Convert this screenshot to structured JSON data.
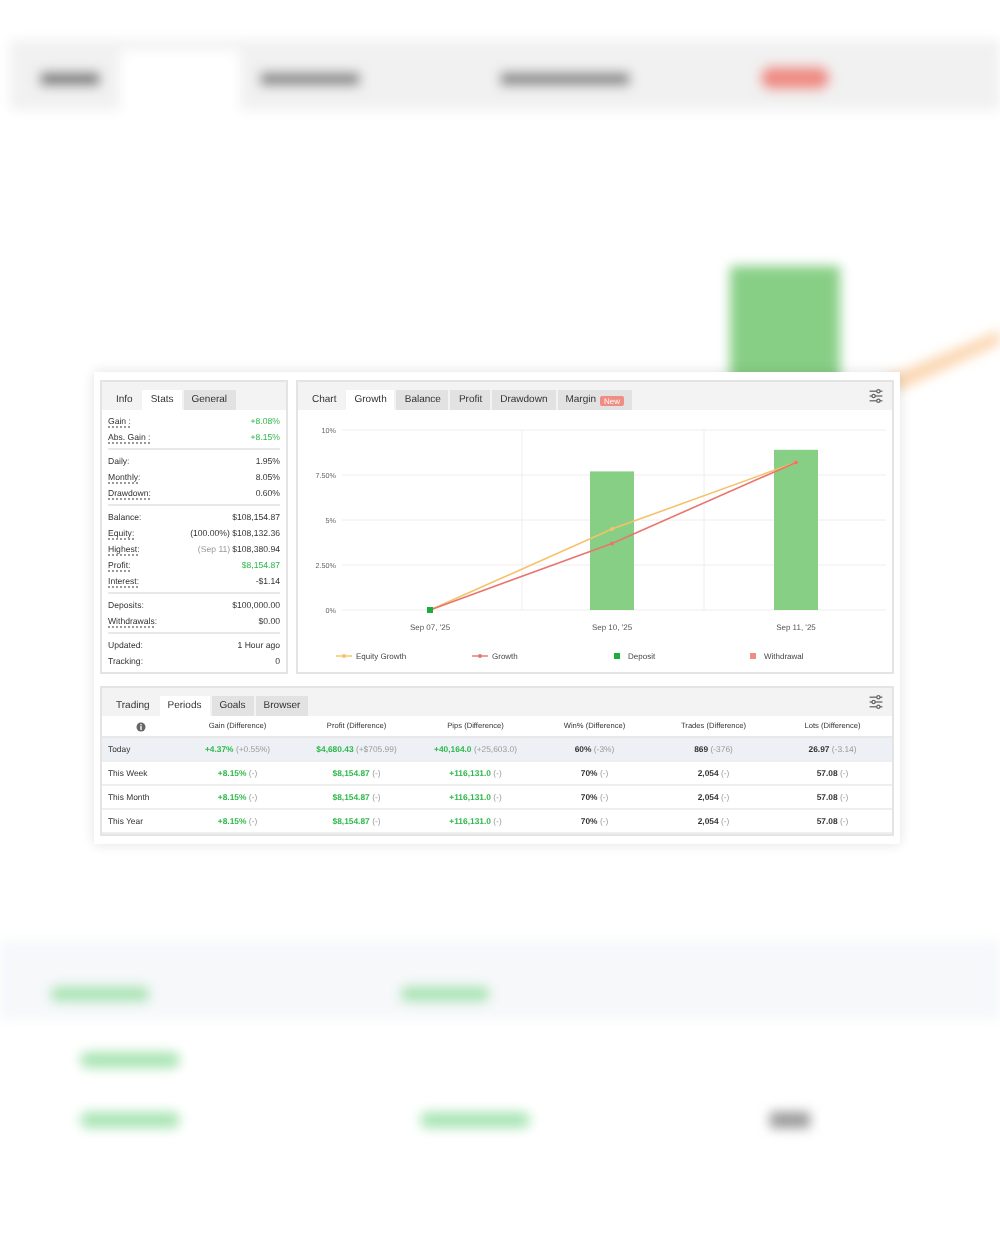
{
  "stats_panel": {
    "title": "Info",
    "tabs": [
      {
        "label": "Stats",
        "selected": true
      },
      {
        "label": "General",
        "selected": false
      }
    ],
    "groups": [
      [
        {
          "label": "Gain :",
          "value": "+8.08%",
          "positive": true,
          "underlined": true
        },
        {
          "label": "Abs. Gain :",
          "value": "+8.15%",
          "positive": true,
          "underlined": true
        }
      ],
      [
        {
          "label": "Daily:",
          "value": "1.95%",
          "positive": false,
          "underlined": false
        },
        {
          "label": "Monthly:",
          "value": "8.05%",
          "positive": false,
          "underlined": true
        },
        {
          "label": "Drawdown:",
          "value": "0.60%",
          "positive": false,
          "underlined": true
        }
      ],
      [
        {
          "label": "Balance:",
          "value": "$108,154.87",
          "positive": false,
          "underlined": false
        },
        {
          "label": "Equity:",
          "value": "(100.00%) $108,132.36",
          "positive": false,
          "underlined": true
        },
        {
          "label": "Highest:",
          "note": "(Sep 11)",
          "value": "$108,380.94",
          "positive": false,
          "underlined": true
        },
        {
          "label": "Profit:",
          "value": "$8,154.87",
          "positive": true,
          "underlined": true
        },
        {
          "label": "Interest:",
          "value": "-$1.14",
          "positive": false,
          "underlined": true
        }
      ],
      [
        {
          "label": "Deposits:",
          "value": "$100,000.00",
          "positive": false,
          "underlined": false
        },
        {
          "label": "Withdrawals:",
          "value": "$0.00",
          "positive": false,
          "underlined": true
        }
      ],
      [
        {
          "label": "Updated:",
          "value": "1 Hour ago",
          "positive": false,
          "underlined": false
        },
        {
          "label": "Tracking:",
          "value": "0",
          "positive": false,
          "underlined": false
        }
      ]
    ]
  },
  "chart_panel": {
    "title": "Chart",
    "tabs": [
      {
        "label": "Growth",
        "selected": true
      },
      {
        "label": "Balance",
        "selected": false
      },
      {
        "label": "Profit",
        "selected": false
      },
      {
        "label": "Drawdown",
        "selected": false
      },
      {
        "label": "Margin",
        "selected": false,
        "badge": "New"
      }
    ],
    "chart_data": {
      "type": "line",
      "grid": true,
      "legend": "bottom",
      "categories": [
        "Sep 07, '25",
        "Sep 10, '25",
        "Sep 11, '25"
      ],
      "ylim": [
        0,
        10
      ],
      "yticks": [
        {
          "value": 0,
          "label": "0%"
        },
        {
          "value": 2.5,
          "label": "2.50%"
        },
        {
          "value": 5,
          "label": "5%"
        },
        {
          "value": 7.5,
          "label": "7.50%"
        },
        {
          "value": 10,
          "label": "10%"
        }
      ],
      "series": [
        {
          "name": "Equity Growth",
          "color": "#f5c26b",
          "type": "line",
          "values": [
            0,
            4.5,
            8.2
          ]
        },
        {
          "name": "Growth",
          "color": "#e8766d",
          "type": "line",
          "values": [
            0,
            3.7,
            8.2
          ]
        },
        {
          "name": "Deposit",
          "color": "#1aae3c",
          "type": "scatter",
          "values": [
            0,
            null,
            null
          ]
        },
        {
          "name": "Withdrawal",
          "color": "#ef8d84",
          "type": "scatter",
          "values": [
            null,
            null,
            null
          ]
        },
        {
          "color": "#88cf86",
          "type": "bar",
          "values": [
            null,
            7.7,
            8.9
          ]
        }
      ]
    }
  },
  "periods_panel": {
    "title": "Trading",
    "tabs": [
      {
        "label": "Periods",
        "selected": true
      },
      {
        "label": "Goals",
        "selected": false
      },
      {
        "label": "Browser",
        "selected": false
      }
    ],
    "columns": [
      "Gain (Difference)",
      "Profit (Difference)",
      "Pips (Difference)",
      "Win% (Difference)",
      "Trades (Difference)",
      "Lots (Difference)"
    ],
    "rows": [
      {
        "label": "Today",
        "highlighted": true,
        "cells": [
          {
            "value": "+4.37%",
            "diff": "(+0.55%)",
            "positive": true
          },
          {
            "value": "$4,680.43",
            "diff": "(+$705.99)",
            "positive": true
          },
          {
            "value": "+40,164.0",
            "diff": "(+25,603.0)",
            "positive": true
          },
          {
            "value": "60%",
            "diff": "(-3%)",
            "positive": false
          },
          {
            "value": "869",
            "diff": "(-376)",
            "positive": false
          },
          {
            "value": "26.97",
            "diff": "(-3.14)",
            "positive": false
          }
        ]
      },
      {
        "label": "This Week",
        "highlighted": false,
        "cells": [
          {
            "value": "+8.15%",
            "diff": "(-)",
            "positive": true
          },
          {
            "value": "$8,154.87",
            "diff": "(-)",
            "positive": true
          },
          {
            "value": "+116,131.0",
            "diff": "(-)",
            "positive": true
          },
          {
            "value": "70%",
            "diff": "(-)",
            "positive": false
          },
          {
            "value": "2,054",
            "diff": "(-)",
            "positive": false
          },
          {
            "value": "57.08",
            "diff": "(-)",
            "positive": false
          }
        ]
      },
      {
        "label": "This Month",
        "highlighted": false,
        "cells": [
          {
            "value": "+8.15%",
            "diff": "(-)",
            "positive": true
          },
          {
            "value": "$8,154.87",
            "diff": "(-)",
            "positive": true
          },
          {
            "value": "+116,131.0",
            "diff": "(-)",
            "positive": true
          },
          {
            "value": "70%",
            "diff": "(-)",
            "positive": false
          },
          {
            "value": "2,054",
            "diff": "(-)",
            "positive": false
          },
          {
            "value": "57.08",
            "diff": "(-)",
            "positive": false
          }
        ]
      },
      {
        "label": "This Year",
        "highlighted": false,
        "cells": [
          {
            "value": "+8.15%",
            "diff": "(-)",
            "positive": true
          },
          {
            "value": "$8,154.87",
            "diff": "(-)",
            "positive": true
          },
          {
            "value": "+116,131.0",
            "diff": "(-)",
            "positive": true
          },
          {
            "value": "70%",
            "diff": "(-)",
            "positive": false
          },
          {
            "value": "2,054",
            "diff": "(-)",
            "positive": false
          },
          {
            "value": "57.08",
            "diff": "(-)",
            "positive": false
          }
        ]
      }
    ]
  }
}
